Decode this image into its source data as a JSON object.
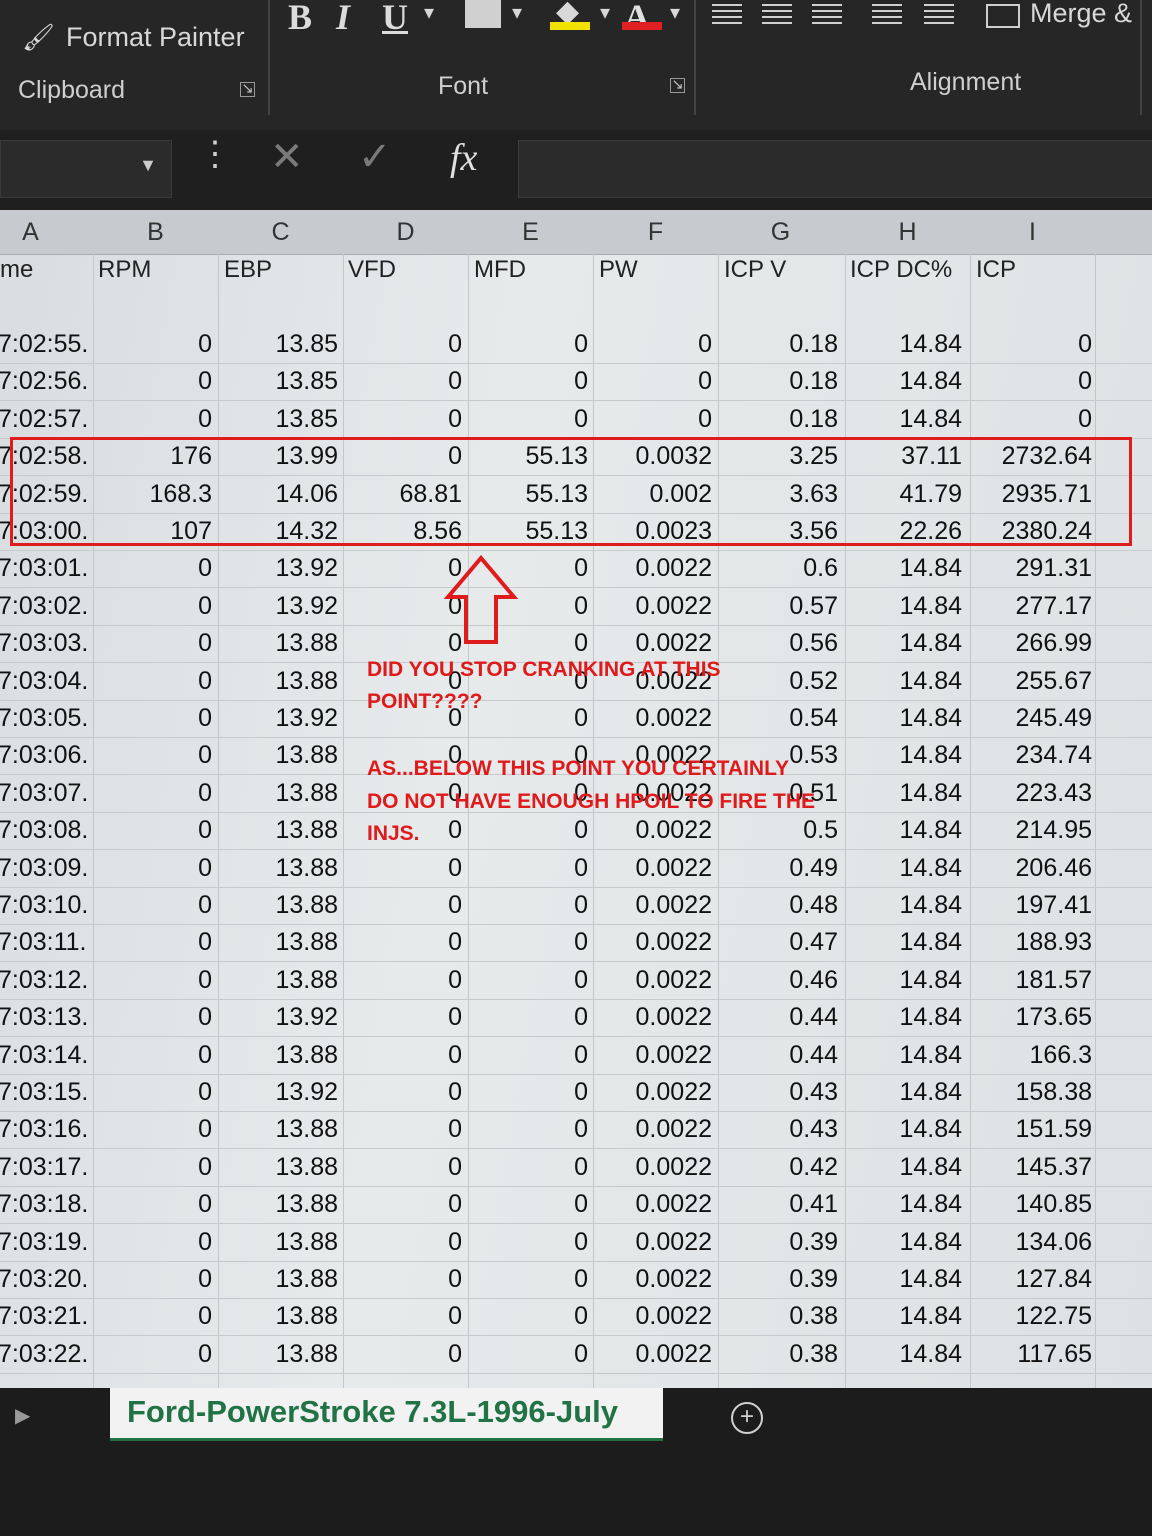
{
  "ribbon": {
    "format_painter": "Format Painter",
    "clipboard": "Clipboard",
    "font": "Font",
    "alignment": "Alignment",
    "bold": "B",
    "italic": "I",
    "underline": "U",
    "merge": "Merge &",
    "font_color": "A",
    "icons": [
      "paintbrush-icon",
      "bold-icon",
      "italic-icon",
      "underline-icon",
      "borders-icon",
      "fill-color-icon",
      "font-color-icon",
      "align-icon",
      "indent-icon",
      "merge-icon"
    ]
  },
  "formula_bar": {
    "fx": "fx",
    "cancel": "✕",
    "enter": "✓",
    "more": "⋮"
  },
  "columns": [
    "A",
    "B",
    "C",
    "D",
    "E",
    "F",
    "G",
    "H",
    "I"
  ],
  "headers": [
    "me",
    "RPM",
    "EBP",
    "VFD",
    "MFD",
    "PW",
    "ICP V",
    "ICP DC%",
    "ICP"
  ],
  "rows": [
    [
      "7:02:55.",
      "0",
      "13.85",
      "0",
      "0",
      "0",
      "0.18",
      "14.84",
      "0"
    ],
    [
      "7:02:56.",
      "0",
      "13.85",
      "0",
      "0",
      "0",
      "0.18",
      "14.84",
      "0"
    ],
    [
      "7:02:57.",
      "0",
      "13.85",
      "0",
      "0",
      "0",
      "0.18",
      "14.84",
      "0"
    ],
    [
      "7:02:58.",
      "176",
      "13.99",
      "0",
      "55.13",
      "0.0032",
      "3.25",
      "37.11",
      "2732.64"
    ],
    [
      "7:02:59.",
      "168.3",
      "14.06",
      "68.81",
      "55.13",
      "0.002",
      "3.63",
      "41.79",
      "2935.71"
    ],
    [
      "7:03:00.",
      "107",
      "14.32",
      "8.56",
      "55.13",
      "0.0023",
      "3.56",
      "22.26",
      "2380.24"
    ],
    [
      "7:03:01.",
      "0",
      "13.92",
      "0",
      "0",
      "0.0022",
      "0.6",
      "14.84",
      "291.31"
    ],
    [
      "7:03:02.",
      "0",
      "13.92",
      "0",
      "0",
      "0.0022",
      "0.57",
      "14.84",
      "277.17"
    ],
    [
      "7:03:03.",
      "0",
      "13.88",
      "0",
      "0",
      "0.0022",
      "0.56",
      "14.84",
      "266.99"
    ],
    [
      "7:03:04.",
      "0",
      "13.88",
      "0",
      "0",
      "0.0022",
      "0.52",
      "14.84",
      "255.67"
    ],
    [
      "7:03:05.",
      "0",
      "13.92",
      "0",
      "0",
      "0.0022",
      "0.54",
      "14.84",
      "245.49"
    ],
    [
      "7:03:06.",
      "0",
      "13.88",
      "0",
      "0",
      "0.0022",
      "0.53",
      "14.84",
      "234.74"
    ],
    [
      "7:03:07.",
      "0",
      "13.88",
      "0",
      "0",
      "0.0022",
      "0.51",
      "14.84",
      "223.43"
    ],
    [
      "7:03:08.",
      "0",
      "13.88",
      "0",
      "0",
      "0.0022",
      "0.5",
      "14.84",
      "214.95"
    ],
    [
      "7:03:09.",
      "0",
      "13.88",
      "0",
      "0",
      "0.0022",
      "0.49",
      "14.84",
      "206.46"
    ],
    [
      "7:03:10.",
      "0",
      "13.88",
      "0",
      "0",
      "0.0022",
      "0.48",
      "14.84",
      "197.41"
    ],
    [
      "7:03:11.",
      "0",
      "13.88",
      "0",
      "0",
      "0.0022",
      "0.47",
      "14.84",
      "188.93"
    ],
    [
      "7:03:12.",
      "0",
      "13.88",
      "0",
      "0",
      "0.0022",
      "0.46",
      "14.84",
      "181.57"
    ],
    [
      "7:03:13.",
      "0",
      "13.92",
      "0",
      "0",
      "0.0022",
      "0.44",
      "14.84",
      "173.65"
    ],
    [
      "7:03:14.",
      "0",
      "13.88",
      "0",
      "0",
      "0.0022",
      "0.44",
      "14.84",
      "166.3"
    ],
    [
      "7:03:15.",
      "0",
      "13.92",
      "0",
      "0",
      "0.0022",
      "0.43",
      "14.84",
      "158.38"
    ],
    [
      "7:03:16.",
      "0",
      "13.88",
      "0",
      "0",
      "0.0022",
      "0.43",
      "14.84",
      "151.59"
    ],
    [
      "7:03:17.",
      "0",
      "13.88",
      "0",
      "0",
      "0.0022",
      "0.42",
      "14.84",
      "145.37"
    ],
    [
      "7:03:18.",
      "0",
      "13.88",
      "0",
      "0",
      "0.0022",
      "0.41",
      "14.84",
      "140.85"
    ],
    [
      "7:03:19.",
      "0",
      "13.88",
      "0",
      "0",
      "0.0022",
      "0.39",
      "14.84",
      "134.06"
    ],
    [
      "7:03:20.",
      "0",
      "13.88",
      "0",
      "0",
      "0.0022",
      "0.39",
      "14.84",
      "127.84"
    ],
    [
      "7:03:21.",
      "0",
      "13.88",
      "0",
      "0",
      "0.0022",
      "0.38",
      "14.84",
      "122.75"
    ],
    [
      "7:03:22.",
      "0",
      "13.88",
      "0",
      "0",
      "0.0022",
      "0.38",
      "14.84",
      "117.65"
    ]
  ],
  "annotation": {
    "line1": "DID YOU STOP CRANKING AT THIS",
    "line2": "POINT????",
    "line3": "AS...BELOW THIS POINT YOU CERTAINLY",
    "line4": "DO NOT HAVE ENOUGH HPOIL TO FIRE THE",
    "line5": "INJS.",
    "color": "#e0191b"
  },
  "sheet_tab": {
    "name": "Ford-PowerStroke 7.3L-1996-July",
    "add": "+"
  },
  "colors": {
    "excel_green": "#217346",
    "ribbon_bg": "#262626"
  }
}
